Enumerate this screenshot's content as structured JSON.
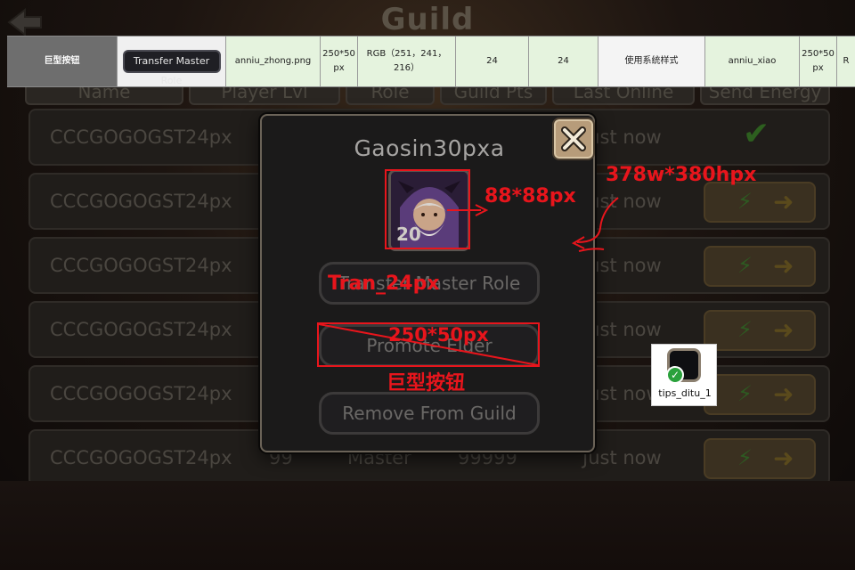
{
  "background": {
    "title": "Guild",
    "headers": [
      "Name",
      "Player Lvl",
      "Role",
      "Guild Pts",
      "Last Online",
      "Send Energy"
    ],
    "rows": [
      {
        "name": "CCCGOGOGST24px",
        "lvl": "",
        "role": "",
        "pts": "",
        "last": "Just now",
        "action": "check"
      },
      {
        "name": "CCCGOGOGST24px",
        "lvl": "",
        "role": "",
        "pts": "",
        "last": "Just now",
        "action": "energy"
      },
      {
        "name": "CCCGOGOGST24px",
        "lvl": "",
        "role": "",
        "pts": "",
        "last": "Just now",
        "action": "energy"
      },
      {
        "name": "CCCGOGOGST24px",
        "lvl": "",
        "role": "",
        "pts": "",
        "last": "Just now",
        "action": "energy"
      },
      {
        "name": "CCCGOGOGST24px",
        "lvl": "",
        "role": "",
        "pts": "",
        "last": "Just now",
        "action": "energy"
      },
      {
        "name": "CCCGOGOGST24px",
        "lvl": "99",
        "role": "Master",
        "pts": "99999",
        "last": "Just now",
        "action": "energy"
      }
    ]
  },
  "spec_table": {
    "cells": [
      "巨型按钮",
      "Transfer Master Role",
      "anniu_zhong.png",
      "250*50 px",
      "RGB（251，241，216）",
      "24",
      "24",
      "使用系统样式",
      "anniu_xiao",
      "250*50 px",
      "R"
    ]
  },
  "modal": {
    "title": "Gaosin30pxa",
    "avatar_level": "20",
    "buttons": {
      "transfer": "Transfer Master Role",
      "promote": "Promote Elder",
      "remove": "Remove From Guild"
    },
    "close_icon": "close-x-icon"
  },
  "annotations": {
    "avatar_size": "88*88px",
    "modal_size": "378w*380hpx",
    "font_size": "Tran_24px",
    "button_size": "250*50px",
    "button_type": "巨型按钮",
    "color": "#e8151c"
  },
  "tips": {
    "label": "tips_ditu_1"
  }
}
